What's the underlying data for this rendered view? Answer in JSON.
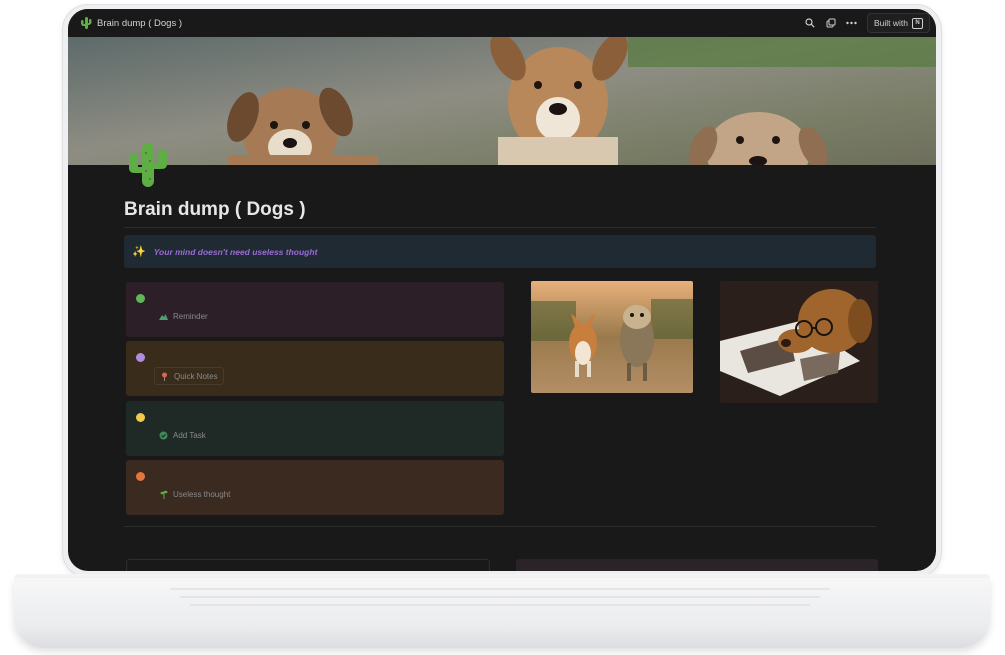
{
  "window": {
    "title": "Brain dump ( Dogs )",
    "built_with_label": "Built with",
    "page_icon": "cactus-icon"
  },
  "toolbar": {
    "icons": [
      "search-icon",
      "duplicate-icon",
      "more-icon"
    ]
  },
  "page": {
    "title": "Brain dump ( Dogs )",
    "callout": {
      "icon": "sparkles-icon",
      "text": "Your mind doesn't need useless thought"
    },
    "cards": [
      {
        "label": "Reminder",
        "dot_color": "#5fb75a",
        "bg": "#2d1f27",
        "icon": "mountain-icon"
      },
      {
        "label": "Quick Notes",
        "dot_color": "#b08be0",
        "bg": "#3a2c1a",
        "icon": "pin-icon"
      },
      {
        "label": "Add Task",
        "dot_color": "#f2c94c",
        "bg": "#1f2a26",
        "icon": "check-circle-icon"
      },
      {
        "label": "Useless thought",
        "dot_color": "#e2763e",
        "bg": "#3a2a1f",
        "icon": "sprout-icon"
      }
    ],
    "images": [
      "dogs-running-photo",
      "dog-reading-photo"
    ]
  },
  "colors": {
    "background": "#191919",
    "callout_bg": "#1f2a33",
    "callout_text": "#9a6bd6"
  }
}
